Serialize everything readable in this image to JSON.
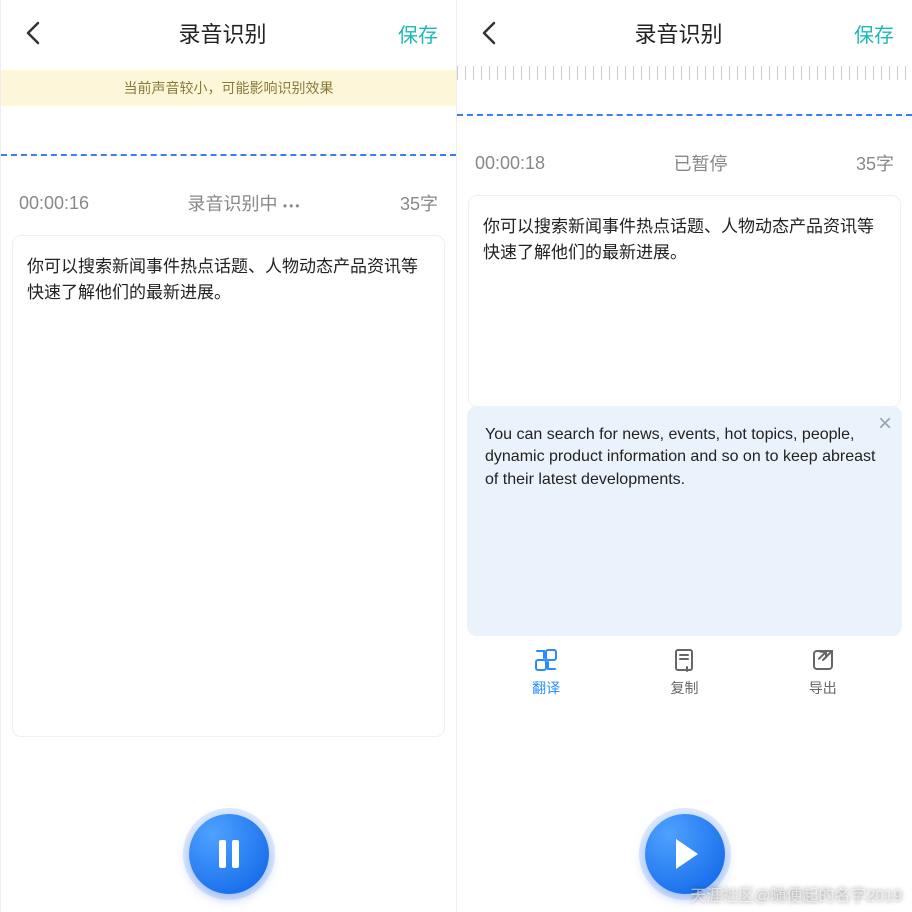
{
  "left": {
    "header": {
      "title": "录音识别",
      "save": "保存"
    },
    "banner": "当前声音较小，可能影响识别效果",
    "status": {
      "time": "00:00:16",
      "state": "录音识别中",
      "count": "35字"
    },
    "transcript": "你可以搜索新闻事件热点话题、人物动态产品资讯等快速了解他们的最新进展。"
  },
  "right": {
    "header": {
      "title": "录音识别",
      "save": "保存"
    },
    "status": {
      "time": "00:00:18",
      "state": "已暂停",
      "count": "35字"
    },
    "transcript": "你可以搜索新闻事件热点话题、人物动态产品资讯等快速了解他们的最新进展。",
    "translation": "You can search for news, events, hot topics, people, dynamic product information and so on to keep abreast of their latest developments.",
    "actions": {
      "translate": "翻译",
      "copy": "复制",
      "export": "导出"
    }
  },
  "watermark": "天涯社区@随便起的名字2019"
}
